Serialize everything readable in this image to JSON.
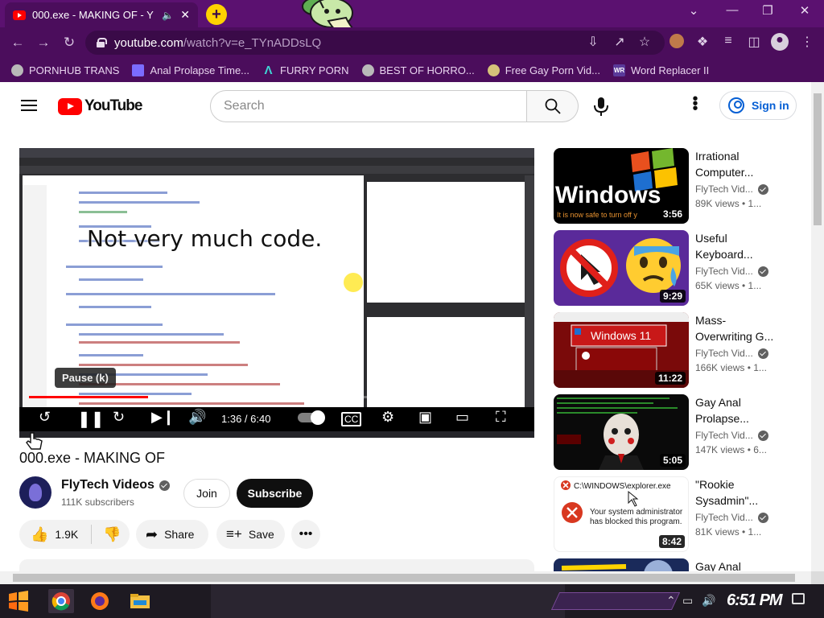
{
  "browser": {
    "tab_title": "000.exe - MAKING OF - Y",
    "url_host": "youtube.com",
    "url_path": "/watch?v=e_TYnADDsLQ",
    "new_tab": "+",
    "bookmarks": [
      {
        "label": "PORNHUB TRANS",
        "icon": "globe-icon",
        "color": "#b9b9b9"
      },
      {
        "label": "Anal Prolapse Time...",
        "icon": "bookmark-icon",
        "color": "#7b6cff"
      },
      {
        "label": "FURRY PORN",
        "icon": "lambda-icon",
        "color": "#3fd4d4"
      },
      {
        "label": "BEST OF HORRO...",
        "icon": "globe-icon",
        "color": "#b9b9b9"
      },
      {
        "label": "Free Gay Porn Vid...",
        "icon": "buddha-icon",
        "color": "#d6c27a"
      },
      {
        "label": "Word Replacer II",
        "icon": "wr-icon",
        "color": "#5a3a9a"
      }
    ]
  },
  "youtube": {
    "logo_text": "YouTube",
    "search_placeholder": "Search",
    "signin_label": "Sign in"
  },
  "player": {
    "caption": "Not very much code.",
    "pause_tooltip": "Pause (k)",
    "time_display": "1:36 / 6:40",
    "progress_fraction": 0.24
  },
  "video": {
    "title": "000.exe - MAKING OF",
    "channel": "FlyTech Videos",
    "subscribers": "111K subscribers",
    "join_label": "Join",
    "subscribe_label": "Subscribe",
    "likes": "1.9K",
    "share_label": "Share",
    "save_label": "Save"
  },
  "recommendations": [
    {
      "title_line1": "Irrational",
      "title_line2": "Computer...",
      "channel": "FlyTech Vid...",
      "stats": "89K views  •  1...",
      "duration": "3:56",
      "thumb": "windows-logo"
    },
    {
      "title_line1": "Useful",
      "title_line2": "Keyboard...",
      "channel": "FlyTech Vid...",
      "stats": "65K views  •  1...",
      "duration": "9:29",
      "thumb": "no-mouse"
    },
    {
      "title_line1": "Mass-",
      "title_line2": "Overwriting G...",
      "channel": "FlyTech Vid...",
      "stats": "166K views  •  1...",
      "duration": "11:22",
      "thumb": "windows11-error"
    },
    {
      "title_line1": "Gay Anal",
      "title_line2": "Prolapse...",
      "channel": "FlyTech Vid...",
      "stats": "147K views  •  6...",
      "duration": "5:05",
      "thumb": "jigsaw"
    },
    {
      "title_line1": "\"Rookie",
      "title_line2": "Sysadmin\"...",
      "channel": "FlyTech Vid...",
      "stats": "81K views  •  1...",
      "duration": "8:42",
      "thumb": "explorer-blocked"
    },
    {
      "title_line1": "Gay Anal",
      "title_line2": "",
      "channel": "",
      "stats": "",
      "duration": "",
      "thumb": "arrow-partial"
    }
  ],
  "thumb_text": {
    "windows_word": "Windows",
    "windows_sub": "It is now safe to turn off y",
    "win11_label": "Windows 11",
    "explorer_path": "C:\\WINDOWS\\explorer.exe",
    "explorer_msg1": "Your system administrator",
    "explorer_msg2": "has blocked this program."
  },
  "taskbar": {
    "clock": "6:51 PM"
  }
}
